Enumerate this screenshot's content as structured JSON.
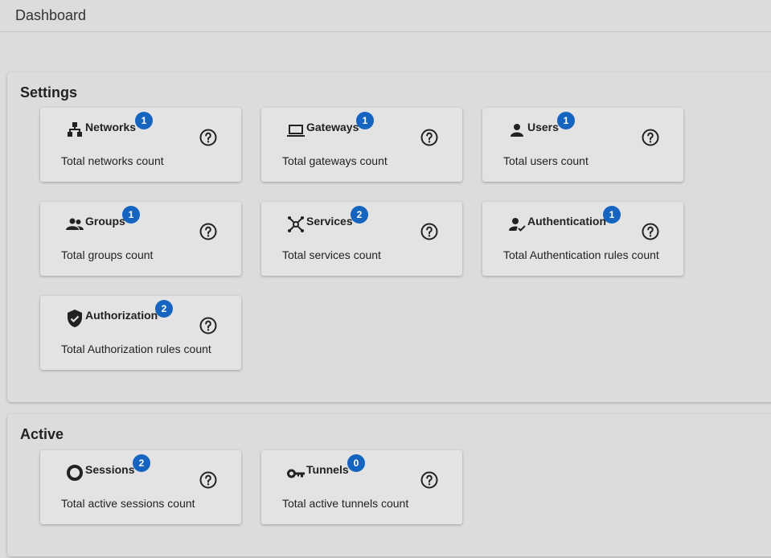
{
  "header": {
    "title": "Dashboard"
  },
  "settings": {
    "title": "Settings",
    "cards": [
      {
        "name": "Networks",
        "badge": "1",
        "description": "Total networks count",
        "icon": "sitemap-icon"
      },
      {
        "name": "Gateways",
        "badge": "1",
        "description": "Total gateways count",
        "icon": "laptop-icon"
      },
      {
        "name": "Users",
        "badge": "1",
        "description": "Total users count",
        "icon": "person-icon"
      },
      {
        "name": "Groups",
        "badge": "1",
        "description": "Total groups count",
        "icon": "people-icon"
      },
      {
        "name": "Services",
        "badge": "2",
        "description": "Total services count",
        "icon": "hub-icon"
      },
      {
        "name": "Authentication",
        "badge": "1",
        "description": "Total Authentication rules count",
        "icon": "person-check-icon"
      },
      {
        "name": "Authorization",
        "badge": "2",
        "description": "Total Authorization rules count",
        "icon": "shield-check-icon"
      }
    ]
  },
  "active": {
    "title": "Active",
    "cards": [
      {
        "name": "Sessions",
        "badge": "2",
        "description": "Total active sessions count",
        "icon": "ring-icon"
      },
      {
        "name": "Tunnels",
        "badge": "0",
        "description": "Total active tunnels count",
        "icon": "key-icon"
      }
    ]
  },
  "colors": {
    "badge": "#1565c0",
    "background": "#dcdcdc",
    "card": "#e3e3e3"
  }
}
